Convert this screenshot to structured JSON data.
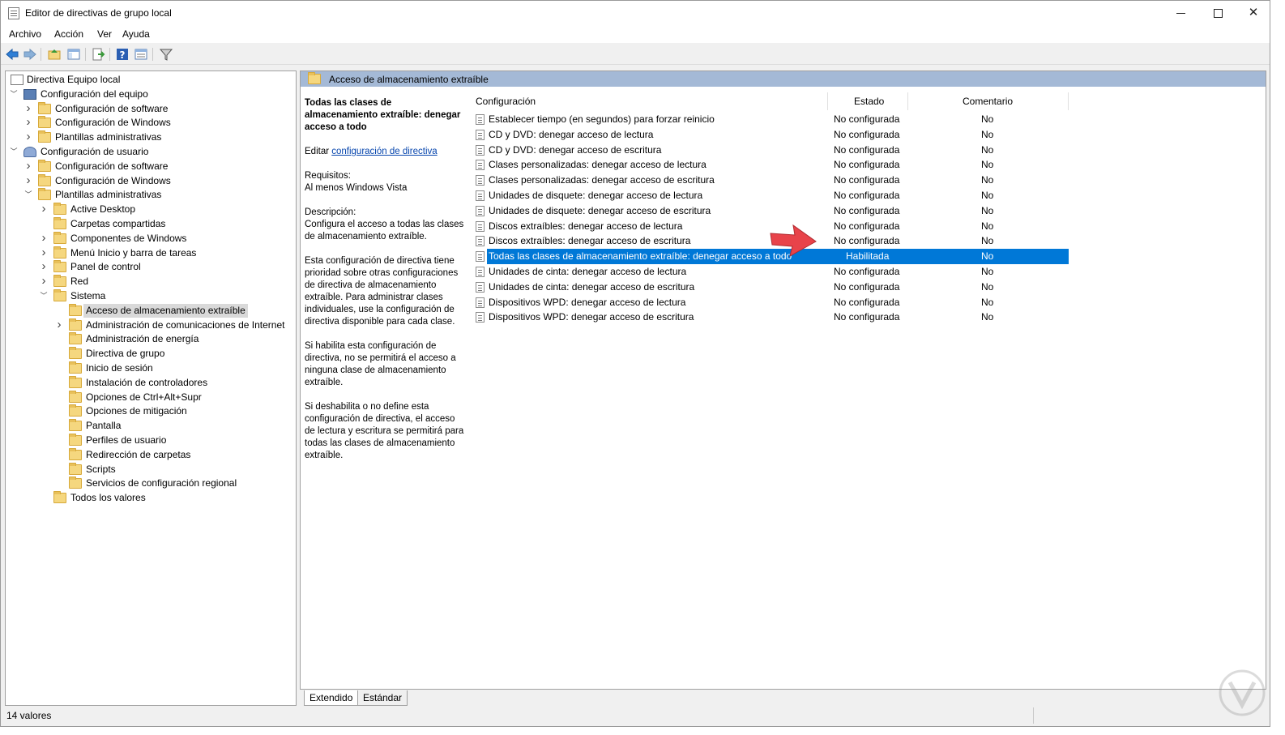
{
  "window": {
    "title": "Editor de directivas de grupo local"
  },
  "menu": [
    "Archivo",
    "Acción",
    "Ver",
    "Ayuda"
  ],
  "toolbar_icons": [
    "back-icon",
    "forward-icon",
    "up-folder-icon",
    "show-hide-tree-icon",
    "export-list-icon",
    "help-icon",
    "extended-view-icon",
    "filter-icon"
  ],
  "tree": [
    {
      "label": "Directiva Equipo local",
      "level": 0,
      "icon": "doc",
      "expander": ""
    },
    {
      "label": "Configuración del equipo",
      "level": 1,
      "icon": "computer",
      "expander": "open"
    },
    {
      "label": "Configuración de software",
      "level": 2,
      "icon": "folder",
      "expander": "closed"
    },
    {
      "label": "Configuración de Windows",
      "level": 2,
      "icon": "folder",
      "expander": "closed"
    },
    {
      "label": "Plantillas administrativas",
      "level": 2,
      "icon": "folder",
      "expander": "closed"
    },
    {
      "label": "Configuración de usuario",
      "level": 1,
      "icon": "user",
      "expander": "open"
    },
    {
      "label": "Configuración de software",
      "level": 2,
      "icon": "folder",
      "expander": "closed"
    },
    {
      "label": "Configuración de Windows",
      "level": 2,
      "icon": "folder",
      "expander": "closed"
    },
    {
      "label": "Plantillas administrativas",
      "level": 2,
      "icon": "folder",
      "expander": "open"
    },
    {
      "label": "Active Desktop",
      "level": 3,
      "icon": "folder",
      "expander": "closed"
    },
    {
      "label": "Carpetas compartidas",
      "level": 3,
      "icon": "folder",
      "expander": ""
    },
    {
      "label": "Componentes de Windows",
      "level": 3,
      "icon": "folder",
      "expander": "closed"
    },
    {
      "label": "Menú Inicio y barra de tareas",
      "level": 3,
      "icon": "folder",
      "expander": "closed"
    },
    {
      "label": "Panel de control",
      "level": 3,
      "icon": "folder",
      "expander": "closed"
    },
    {
      "label": "Red",
      "level": 3,
      "icon": "folder",
      "expander": "closed"
    },
    {
      "label": "Sistema",
      "level": 3,
      "icon": "folder",
      "expander": "open"
    },
    {
      "label": "Acceso de almacenamiento extraíble",
      "level": 4,
      "icon": "folder",
      "expander": "",
      "selected": true
    },
    {
      "label": "Administración de comunicaciones de Internet",
      "level": 4,
      "icon": "folder",
      "expander": "closed"
    },
    {
      "label": "Administración de energía",
      "level": 4,
      "icon": "folder",
      "expander": ""
    },
    {
      "label": "Directiva de grupo",
      "level": 4,
      "icon": "folder",
      "expander": ""
    },
    {
      "label": "Inicio de sesión",
      "level": 4,
      "icon": "folder",
      "expander": ""
    },
    {
      "label": "Instalación de controladores",
      "level": 4,
      "icon": "folder",
      "expander": ""
    },
    {
      "label": "Opciones de Ctrl+Alt+Supr",
      "level": 4,
      "icon": "folder",
      "expander": ""
    },
    {
      "label": "Opciones de mitigación",
      "level": 4,
      "icon": "folder",
      "expander": ""
    },
    {
      "label": "Pantalla",
      "level": 4,
      "icon": "folder",
      "expander": ""
    },
    {
      "label": "Perfiles de usuario",
      "level": 4,
      "icon": "folder",
      "expander": ""
    },
    {
      "label": "Redirección de carpetas",
      "level": 4,
      "icon": "folder",
      "expander": ""
    },
    {
      "label": "Scripts",
      "level": 4,
      "icon": "folder",
      "expander": ""
    },
    {
      "label": "Servicios de configuración regional",
      "level": 4,
      "icon": "folder",
      "expander": ""
    },
    {
      "label": "Todos los valores",
      "level": 3,
      "icon": "folder-settings",
      "expander": ""
    }
  ],
  "right_pane": {
    "header": "Acceso de almacenamiento extraíble",
    "description": {
      "title": "Todas las clases de almacenamiento extraíble: denegar acceso a todo",
      "edit_prefix": "Editar",
      "edit_link": "configuración de directiva",
      "requirements": "Requisitos:\nAl menos Windows Vista",
      "description": "Descripción:\nConfigura el acceso a todas las clases de almacenamiento extraíble.",
      "para1": "Esta configuración de directiva tiene prioridad sobre otras configuraciones de directiva de almacenamiento extraíble. Para administrar clases individuales, use la configuración de directiva disponible para cada clase.",
      "para2": "Si habilita esta configuración de directiva, no se permitirá el acceso a ninguna clase de almacenamiento extraíble.",
      "para3": "Si deshabilita o no define esta configuración de directiva, el acceso de lectura y escritura se permitirá para todas las clases de almacenamiento extraíble."
    },
    "columns": [
      "Configuración",
      "Estado",
      "Comentario"
    ],
    "rows": [
      {
        "name": "Establecer tiempo (en segundos) para forzar reinicio",
        "state": "No configurada",
        "comment": "No"
      },
      {
        "name": "CD y DVD: denegar acceso de lectura",
        "state": "No configurada",
        "comment": "No"
      },
      {
        "name": "CD y DVD: denegar acceso de escritura",
        "state": "No configurada",
        "comment": "No"
      },
      {
        "name": "Clases personalizadas: denegar acceso de lectura",
        "state": "No configurada",
        "comment": "No"
      },
      {
        "name": "Clases personalizadas: denegar acceso de escritura",
        "state": "No configurada",
        "comment": "No"
      },
      {
        "name": "Unidades de disquete: denegar acceso de lectura",
        "state": "No configurada",
        "comment": "No"
      },
      {
        "name": "Unidades de disquete: denegar acceso de escritura",
        "state": "No configurada",
        "comment": "No"
      },
      {
        "name": "Discos extraíbles: denegar acceso de lectura",
        "state": "No configurada",
        "comment": "No"
      },
      {
        "name": "Discos extraíbles: denegar acceso de escritura",
        "state": "No configurada",
        "comment": "No"
      },
      {
        "name": "Todas las clases de almacenamiento extraíble: denegar acceso a todo",
        "state": "Habilitada",
        "comment": "No",
        "selected": true
      },
      {
        "name": "Unidades de cinta: denegar acceso de lectura",
        "state": "No configurada",
        "comment": "No"
      },
      {
        "name": "Unidades de cinta: denegar acceso de escritura",
        "state": "No configurada",
        "comment": "No"
      },
      {
        "name": "Dispositivos WPD: denegar acceso de lectura",
        "state": "No configurada",
        "comment": "No"
      },
      {
        "name": "Dispositivos WPD: denegar acceso de escritura",
        "state": "No configurada",
        "comment": "No"
      }
    ],
    "tabs": [
      "Extendido",
      "Estándar"
    ]
  },
  "status": "14 valores",
  "colors": {
    "selection": "#0078d7",
    "header_bar": "#a4b9d6",
    "arrow": "#e8434a",
    "folder": "#f5d77f"
  }
}
